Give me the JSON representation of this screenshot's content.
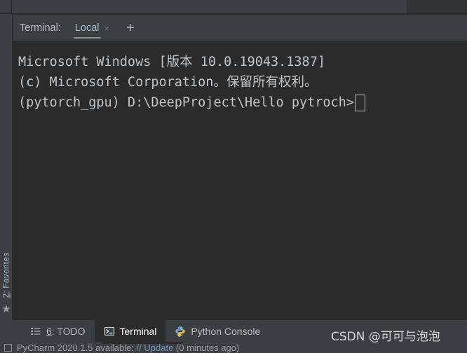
{
  "terminal_tabbar": {
    "label": "Terminal:",
    "tab_name": "Local",
    "close_icon": "×",
    "add_icon": "+"
  },
  "console": {
    "lines": [
      {
        "id": "l1",
        "text": "Microsoft Windows [版本 10.0.19043.1387]"
      },
      {
        "id": "l2",
        "text": "(c) Microsoft Corporation。保留所有权利。"
      },
      {
        "id": "l3",
        "text": ""
      },
      {
        "id": "l4",
        "text": ""
      }
    ],
    "prompt": "(pytorch_gpu) D:\\DeepProject\\Hello pytroch>",
    "cursor": "block-outline-cursor"
  },
  "left_toolbar": {
    "favorites_number": "2",
    "favorites_label": ": Favorites",
    "star_icon": "★"
  },
  "bottom_toolbar": {
    "buttons": [
      {
        "id": "todo",
        "number": "6",
        "label": ": TODO",
        "icon": "list-icon",
        "active": false
      },
      {
        "id": "terminal",
        "number": "",
        "label": "Terminal",
        "icon": "terminal-icon",
        "active": true
      },
      {
        "id": "python-console",
        "number": "",
        "label": "Python Console",
        "icon": "python-icon",
        "active": false
      }
    ]
  },
  "status_bar": {
    "text_prefix": "PyCharm 2020.1.5 available: ",
    "link_text": "// Update",
    "text_suffix": "  (0 minutes ago)"
  },
  "watermark": {
    "text": "CSDN @可可与泡泡"
  },
  "colors": {
    "console_bg": "#2b2b2b",
    "chrome_bg": "#3c3f41",
    "console_text": "#bfc4c9",
    "tab_active_text": "#a7bccd",
    "accent_underline": "#8a8f91"
  }
}
